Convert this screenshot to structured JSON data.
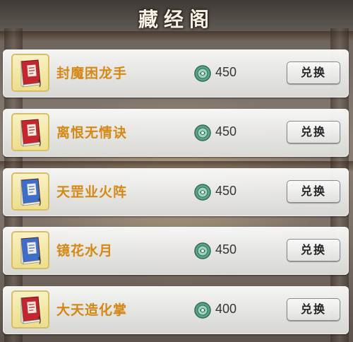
{
  "title": "藏经阁",
  "exchange_label": "兑换",
  "items": [
    {
      "name": "封魔困龙手",
      "price": "450",
      "book_color": "#c8232d",
      "book_icon": "red-book-icon"
    },
    {
      "name": "离恨无情诀",
      "price": "450",
      "book_color": "#c8232d",
      "book_icon": "red-book-icon"
    },
    {
      "name": "天罡业火阵",
      "price": "450",
      "book_color": "#3a6fd0",
      "book_icon": "blue-book-icon"
    },
    {
      "name": "镜花水月",
      "price": "450",
      "book_color": "#3a6fd0",
      "book_icon": "blue-book-icon"
    },
    {
      "name": "大天造化掌",
      "price": "400",
      "book_color": "#c8232d",
      "book_icon": "red-book-icon"
    }
  ],
  "currency_icon": "jade-coin-icon",
  "colors": {
    "item_name": "#d98a12",
    "icon_frame": "#f3e38e"
  }
}
